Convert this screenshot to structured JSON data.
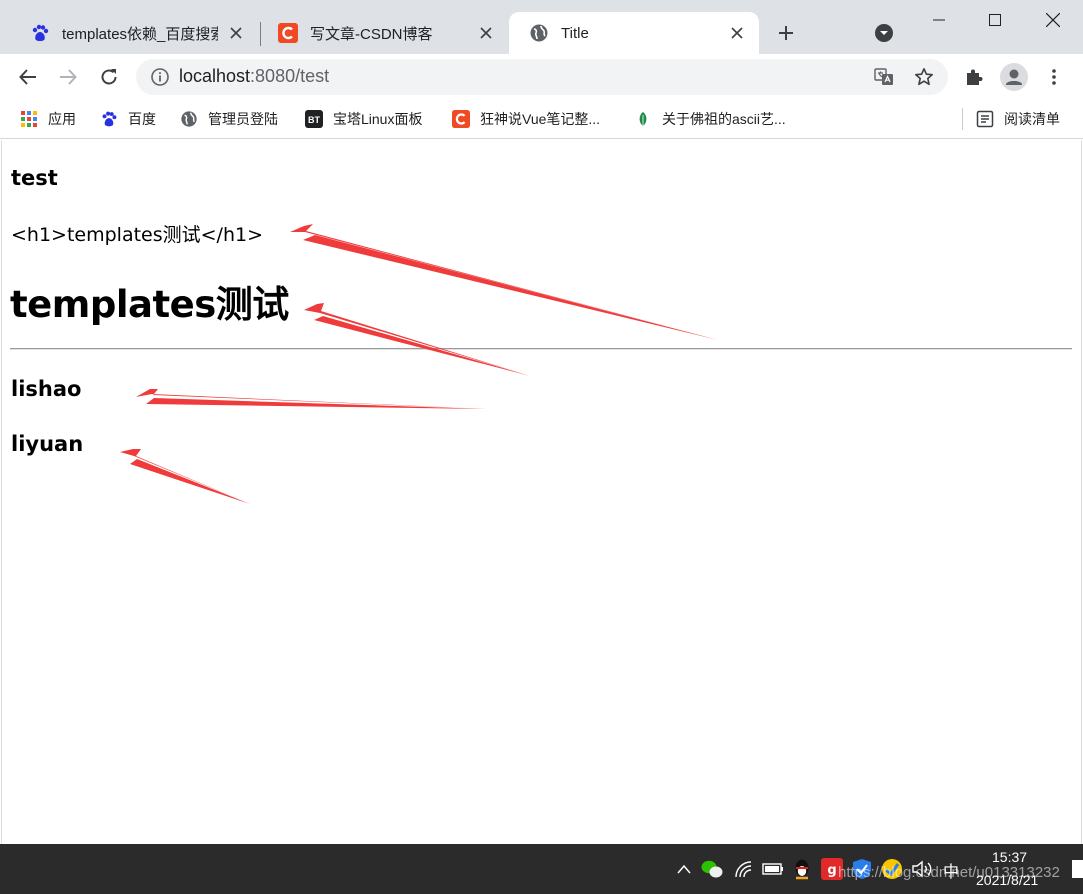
{
  "tabs": [
    {
      "title": "templates依赖_百度搜索",
      "icon": "baidu-paw-icon",
      "active": false
    },
    {
      "title": "写文章-CSDN博客",
      "icon": "csdn-icon",
      "active": false
    },
    {
      "title": "Title",
      "icon": "globe-icon",
      "active": true
    }
  ],
  "toolbar": {
    "url_host": "localhost",
    "url_rest": ":8080/test"
  },
  "bookmarks": [
    {
      "label": "应用",
      "icon": "apps-grid-icon"
    },
    {
      "label": "百度",
      "icon": "baidu-paw-icon"
    },
    {
      "label": "管理员登陆",
      "icon": "globe-icon"
    },
    {
      "label": "宝塔Linux面板",
      "icon": "bt-icon"
    },
    {
      "label": "狂神说Vue笔记整...",
      "icon": "csdn-icon"
    },
    {
      "label": "关于佛祖的ascii艺...",
      "icon": "leaf-icon"
    }
  ],
  "reading_list": "阅读清单",
  "content": {
    "heading_test": "test",
    "escaped_text": "<h1>templates测试</h1>",
    "big_heading": "templates测试",
    "users": [
      "lishao",
      "liyuan"
    ]
  },
  "taskbar": {
    "ime": "中",
    "time": "15:37",
    "date": "2021/8/21",
    "watermark": "https://blog.csdn.net/u013313232"
  },
  "colors": {
    "arrow": "#ef3b3b",
    "tabstrip": "#dee1e6",
    "taskbar": "#2b2b2b"
  }
}
